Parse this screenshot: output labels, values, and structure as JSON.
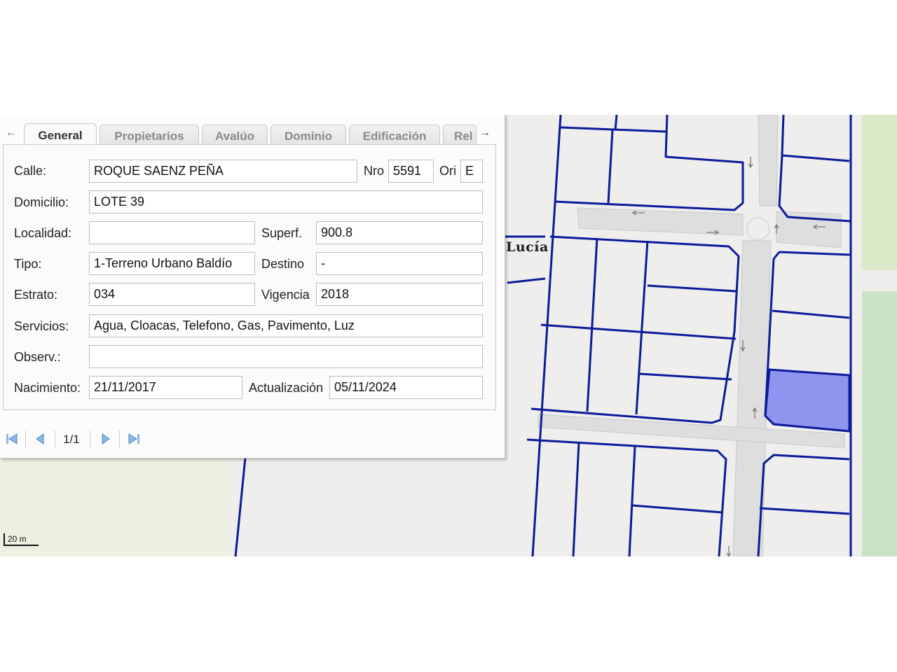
{
  "tabs": [
    {
      "label": "General",
      "active": true
    },
    {
      "label": "Propietarios",
      "active": false
    },
    {
      "label": "Avalúo",
      "active": false
    },
    {
      "label": "Dominio",
      "active": false
    },
    {
      "label": "Edificación",
      "active": false
    },
    {
      "label": "Rel",
      "active": false
    }
  ],
  "form": {
    "calle_label": "Calle:",
    "calle_value": "ROQUE SAENZ PEÑA",
    "nro_label": "Nro",
    "nro_value": "5591",
    "ori_label": "Ori",
    "ori_value": "E",
    "domicilio_label": "Domicilio:",
    "domicilio_value": "LOTE 39",
    "localidad_label": "Localidad:",
    "localidad_value": "",
    "superf_label": "Superf.",
    "superf_value": "900.8",
    "tipo_label": "Tipo:",
    "tipo_value": "1-Terreno Urbano Baldío",
    "destino_label": "Destino",
    "destino_value": "-",
    "estrato_label": "Estrato:",
    "estrato_value": "034",
    "vigencia_label": "Vigencia",
    "vigencia_value": "2018",
    "servicios_label": "Servicios:",
    "servicios_value": "Agua, Cloacas, Telefono, Gas, Pavimento, Luz",
    "observ_label": "Observ.:",
    "observ_value": "",
    "nacimiento_label": "Nacimiento:",
    "nacimiento_value": "21/11/2017",
    "actualizacion_label": "Actualización",
    "actualizacion_value": "05/11/2024"
  },
  "pager": {
    "label": "1/1"
  },
  "map": {
    "street_label": "Lucía",
    "scale_label": "20 m"
  },
  "colors": {
    "parcel_outline": "#0b1a9a",
    "selected_parcel": "#8f95ee",
    "park": "#dbe9c9"
  }
}
